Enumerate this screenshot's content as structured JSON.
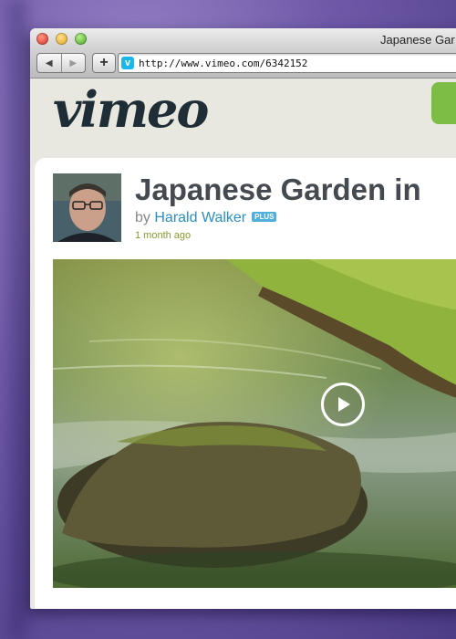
{
  "browser": {
    "window_title": "Japanese Gar",
    "url": "http://www.vimeo.com/6342152",
    "favicon_letter": "v",
    "back_icon": "back-arrow-icon",
    "forward_icon": "forward-arrow-icon",
    "add_label": "+"
  },
  "site": {
    "logo": "vimeo",
    "brand_green": "#7dbd45",
    "brand_blue": "#1ab7ea"
  },
  "video": {
    "title": "Japanese Garden in",
    "by_prefix": "by",
    "author": "Harald Walker",
    "author_badge": "PLUS",
    "posted": "1 month ago",
    "play_icon": "play-icon"
  }
}
